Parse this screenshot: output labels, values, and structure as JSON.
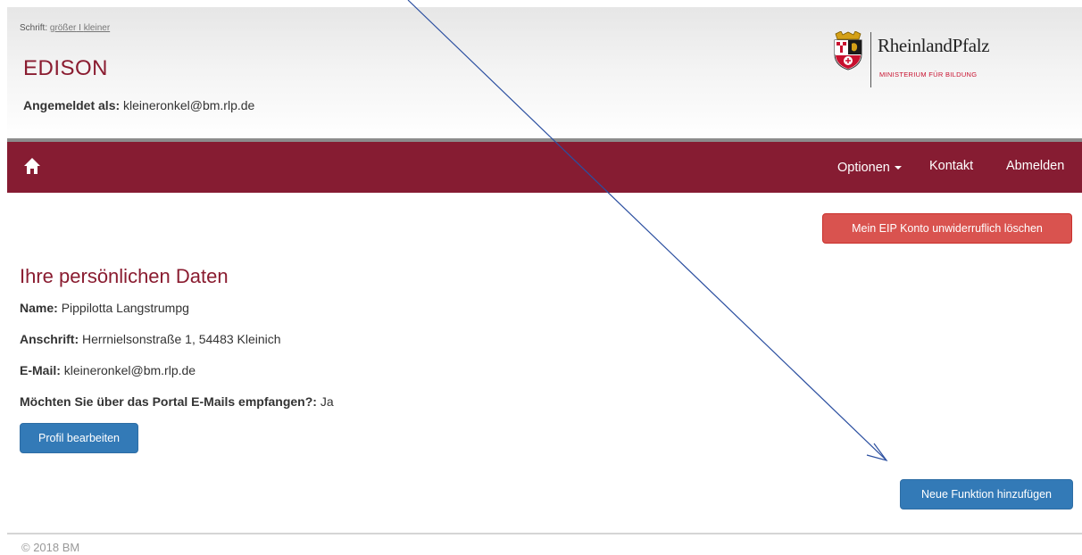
{
  "header": {
    "font_size_prefix": "Schrift: ",
    "font_size_larger": "größer",
    "font_size_separator": " I ",
    "font_size_smaller": "kleiner",
    "app_title": "EDISON",
    "logged_in_label": "Angemeldet als:",
    "logged_in_user": "kleineronkel@bm.rlp.de"
  },
  "logo": {
    "name": "RheinlandPfalz",
    "subtitle": "MINISTERIUM FÜR BILDUNG",
    "icon": "coat-of-arms"
  },
  "navbar": {
    "home_icon": "home-icon",
    "options": "Optionen",
    "contact": "Kontakt",
    "logout": "Abmelden"
  },
  "actions": {
    "delete_account": "Mein EIP Konto unwiderruflich löschen",
    "edit_profile": "Profil bearbeiten",
    "add_function": "Neue Funktion hinzufügen"
  },
  "profile": {
    "title": "Ihre persönlichen Daten",
    "name_label": "Name:",
    "name_value": "Pippilotta Langstrumpg",
    "address_label": "Anschrift:",
    "address_value": "Herrnielsonstraße 1, 54483 Kleinich",
    "email_label": "E-Mail:",
    "email_value": "kleineronkel@bm.rlp.de",
    "emails_opt_label": "Möchten Sie über das Portal E-Mails empfangen?:",
    "emails_opt_value": "Ja"
  },
  "footer": {
    "copyright": "© 2018 BM"
  },
  "colors": {
    "brand": "#861c32",
    "title": "#8a1c30",
    "danger": "#d9534f",
    "primary": "#337ab7",
    "annotation_arrow": "#2b4fa0"
  }
}
